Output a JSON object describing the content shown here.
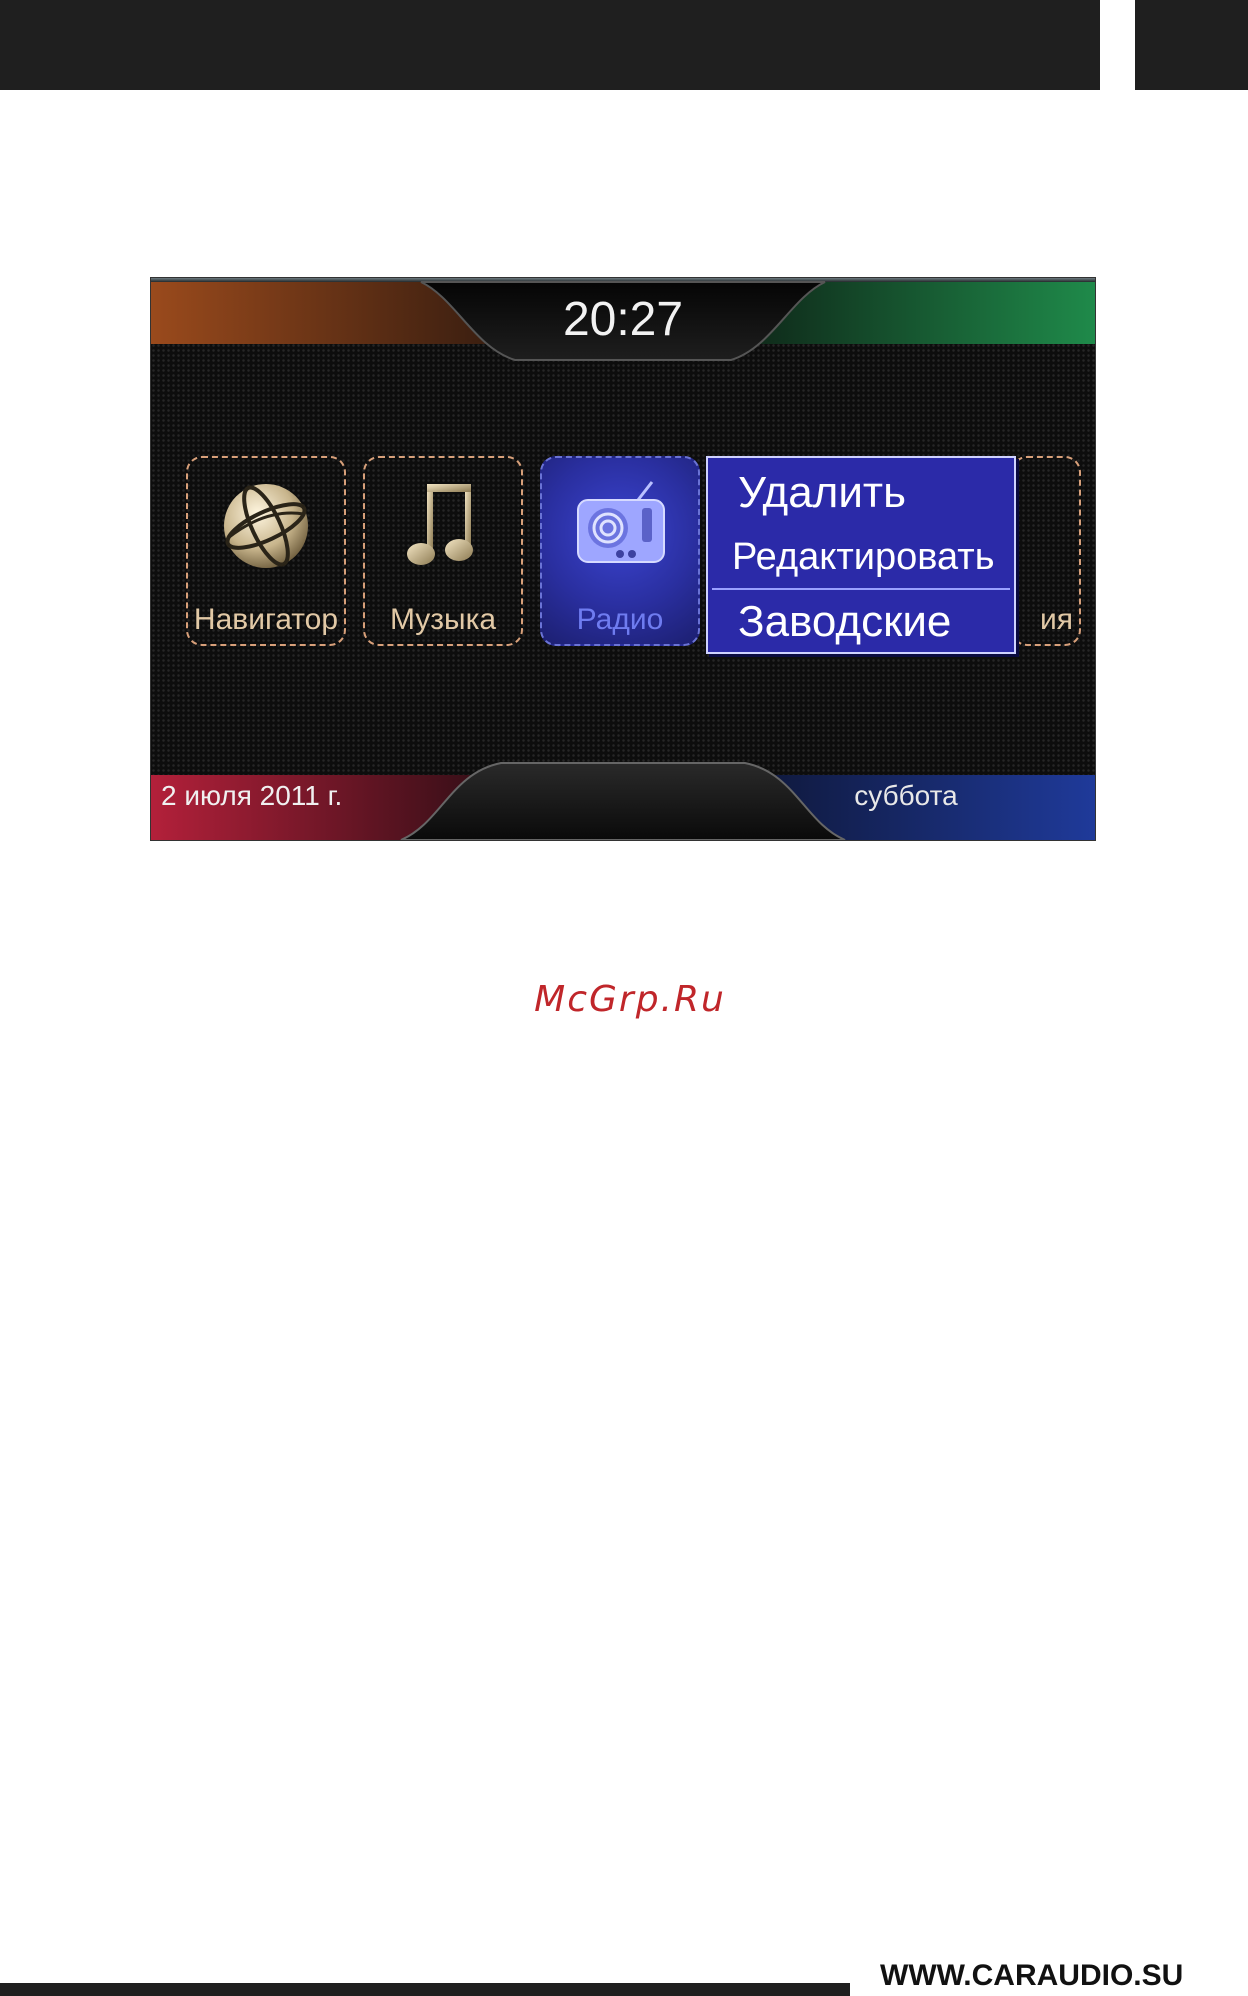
{
  "site_url": "WWW.CARAUDIO.SU",
  "watermark": "McGrp.Ru",
  "screen": {
    "clock": "20:27",
    "date": "2 июля 2011 г.",
    "weekday": "суббота",
    "tiles": [
      {
        "label": "Навигатор",
        "icon": "globe-icon"
      },
      {
        "label": "Музыка",
        "icon": "music-note-icon"
      },
      {
        "label": "Радио",
        "icon": "radio-icon",
        "selected": true
      },
      {
        "label": "ия",
        "icon": ""
      }
    ],
    "context_menu": {
      "items": [
        "Удалить",
        "Редактировать",
        "Заводские"
      ]
    }
  },
  "colors": {
    "top_left_accent": "#9a4a1c",
    "top_right_accent": "#1f8a4a",
    "bottom_left_accent": "#b3203a",
    "bottom_right_accent": "#1f3a9a",
    "menu_bg": "#2b2aa8",
    "tile_border": "#d8a07a",
    "tile_label": "#e2c9a6",
    "watermark": "#c0262a"
  }
}
